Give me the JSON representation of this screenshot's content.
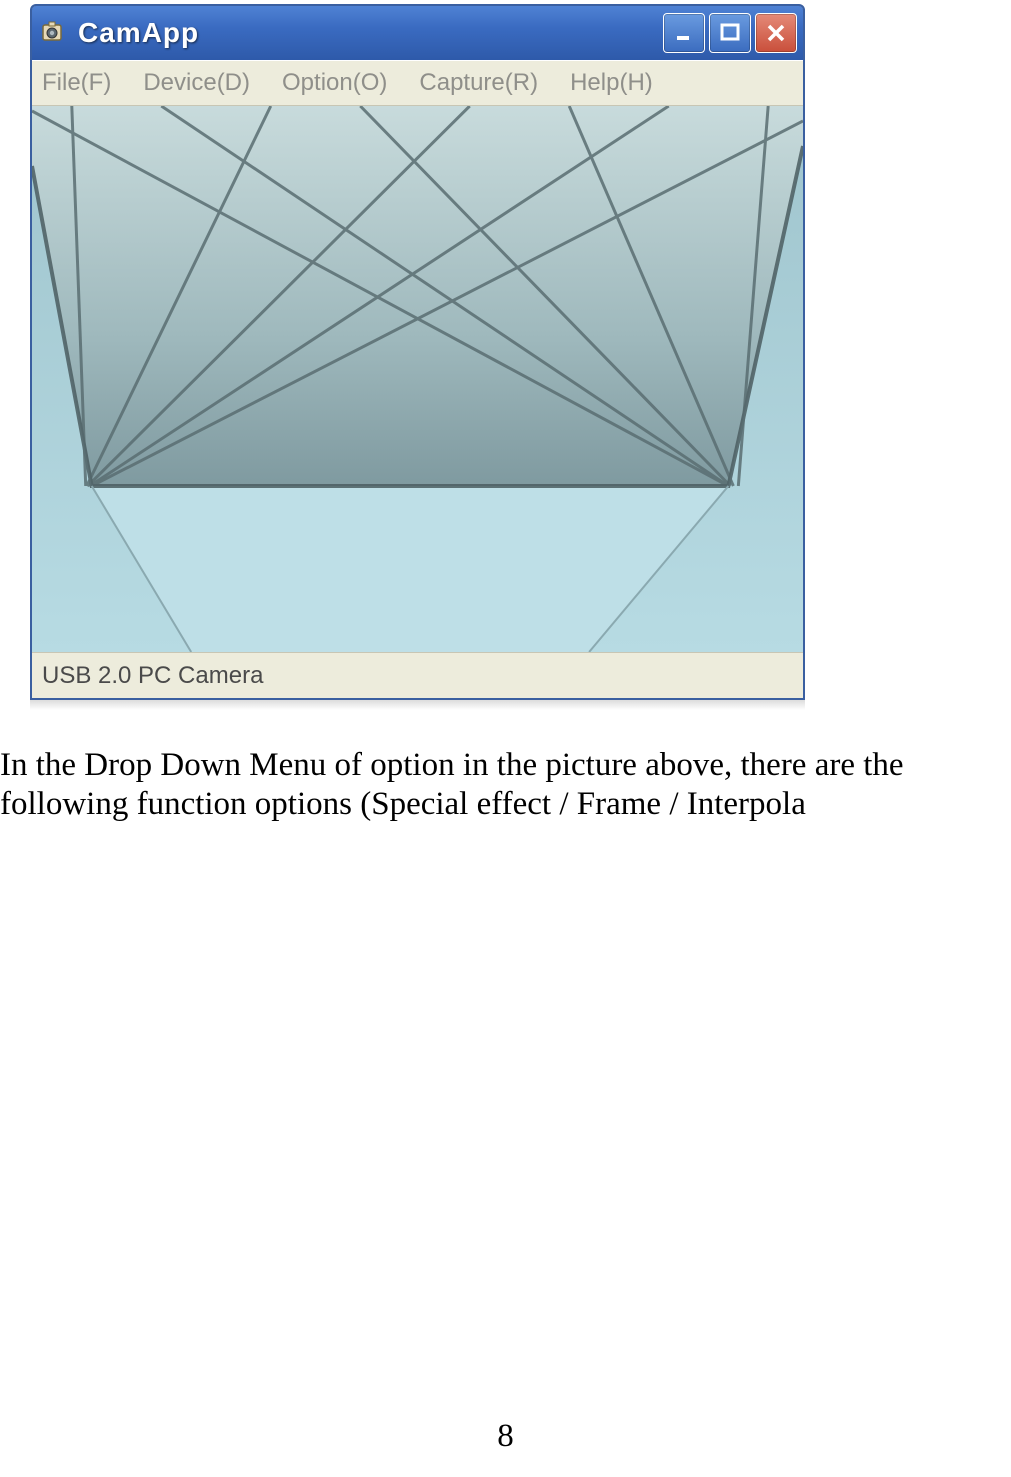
{
  "window": {
    "title": "CamApp",
    "menu": {
      "items": [
        {
          "label": "File(F)"
        },
        {
          "label": "Device(D)"
        },
        {
          "label": "Option(O)"
        },
        {
          "label": "Capture(R)"
        },
        {
          "label": "Help(H)"
        }
      ]
    },
    "status": "USB 2.0 PC Camera"
  },
  "body": {
    "paragraph": "In the Drop Down Menu of option in the picture above, there are the following function options (Special effect / Frame / Interpola"
  },
  "page_number": "8"
}
